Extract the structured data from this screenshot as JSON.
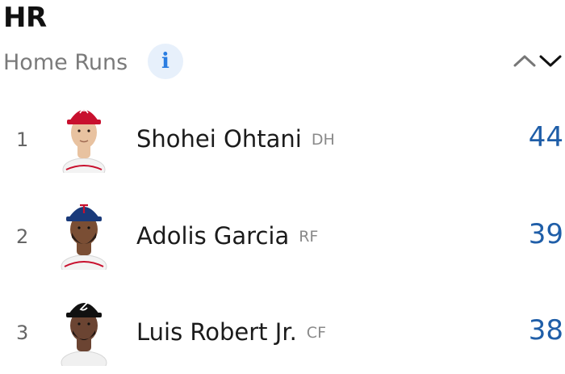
{
  "header": {
    "title": "HR",
    "subtitle": "Home Runs",
    "info_icon": "info-icon",
    "sort_icon": "sort-up-down-chevron-icon"
  },
  "leaders": [
    {
      "rank": "1",
      "name": "Shohei Ohtani",
      "position": "DH",
      "value": "44",
      "cap_color": "#c8102e",
      "shirt_color": "#f3f3f3",
      "skin_color": "#e8c2a0",
      "hair_color": "#2a1d17"
    },
    {
      "rank": "2",
      "name": "Adolis Garcia",
      "position": "RF",
      "value": "39",
      "cap_color": "#1a3a7a",
      "shirt_color": "#f3f3f3",
      "skin_color": "#7a4e34",
      "hair_color": "#2a1d17"
    },
    {
      "rank": "3",
      "name": "Luis Robert Jr.",
      "position": "CF",
      "value": "38",
      "cap_color": "#111111",
      "shirt_color": "#f0f0f0",
      "skin_color": "#6b4432",
      "hair_color": "#1a1210"
    }
  ],
  "colors": {
    "accent": "#1f5ea8",
    "info": "#2a7de1"
  }
}
